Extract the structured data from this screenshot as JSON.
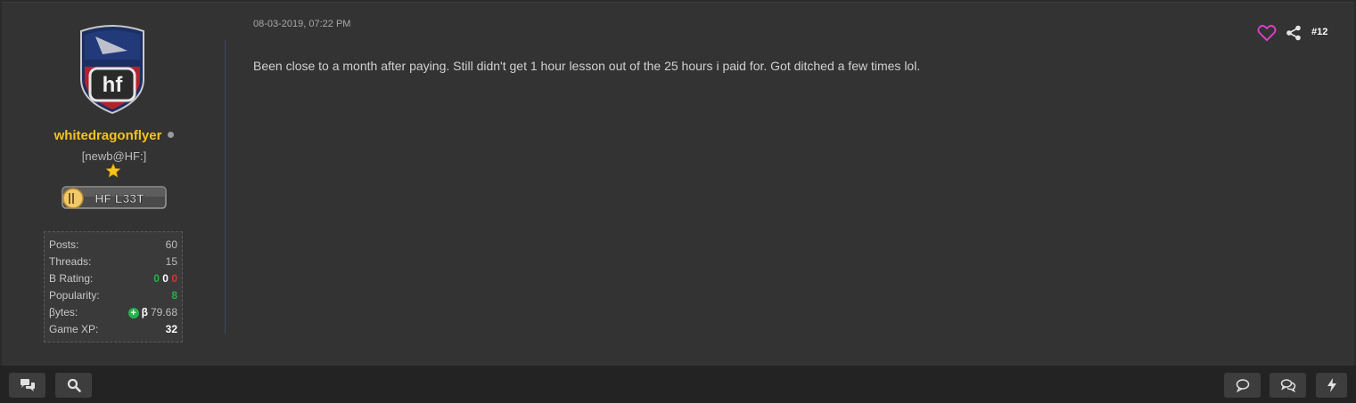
{
  "post": {
    "date": "08-03-2019, 07:22 PM",
    "message": "Been close to a month after paying. Still didn't get 1 hour lesson out of the 25 hours i paid for. Got ditched a few times lol.",
    "post_number": "#12"
  },
  "user": {
    "avatar_icon": "hf-shield-logo",
    "username": "whitedragonflyer",
    "username_color": "#f6c21a",
    "status": "offline",
    "title": "[newb@HF:]",
    "rank_icon": "star-icon",
    "badge_icon": "hf-l33t-badge",
    "stats": {
      "posts_label": "Posts:",
      "posts": "60",
      "threads_label": "Threads:",
      "threads": "15",
      "b_rating_label": "B Rating:",
      "b_rating_positive": "0",
      "b_rating_neutral": "0",
      "b_rating_negative": "0",
      "popularity_label": "Popularity:",
      "popularity": "8",
      "bytes_label": "βytes:",
      "bytes_symbol": "β",
      "bytes": "79.68",
      "game_xp_label": "Game XP:",
      "game_xp": "32"
    }
  },
  "actions": {
    "like_icon": "heart-icon",
    "share_icon": "share-icon",
    "accent": "#e040c8"
  },
  "bottom_bar": {
    "left_buttons": [
      "chat-bubbles-icon",
      "search-icon"
    ],
    "right_buttons": [
      "comment-icon",
      "conversation-icon",
      "lightning-icon"
    ]
  }
}
